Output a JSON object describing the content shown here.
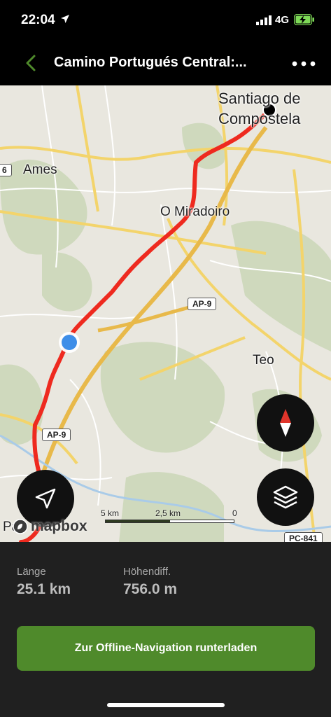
{
  "status_bar": {
    "time": "22:04",
    "network": "4G",
    "icons": [
      "location-arrow-icon",
      "signal-bars-icon",
      "battery-charging-icon"
    ]
  },
  "nav": {
    "title": "Camino Portugués Central:...",
    "back_icon": "chevron-left-icon",
    "more_icon": "more-dots-icon",
    "accent_color": "#4f8a2b"
  },
  "map": {
    "labels": {
      "santiago": "Santiago de Compostela",
      "ames": "Ames",
      "mirador": "O Miradoiro",
      "teo": "Teo",
      "pa": "Pa"
    },
    "road_shields": {
      "ap9_upper": "AP-9",
      "ap9_lower": "AP-9",
      "pc841": "PC-841",
      "six": "6"
    },
    "scale": {
      "left": "5 km",
      "mid": "2,5 km",
      "right": "0"
    },
    "attribution": "mapbox",
    "route_color": "#ee2a1f",
    "buttons": {
      "compass_icon": "compass-icon",
      "layers_icon": "layers-icon",
      "locate_icon": "location-arrow-icon"
    }
  },
  "stats": {
    "length_label": "Länge",
    "length_value": "25.1 km",
    "elevation_label": "Höhendiff.",
    "elevation_value": "756.0 m"
  },
  "download_button": "Zur Offline-Navigation runterladen"
}
